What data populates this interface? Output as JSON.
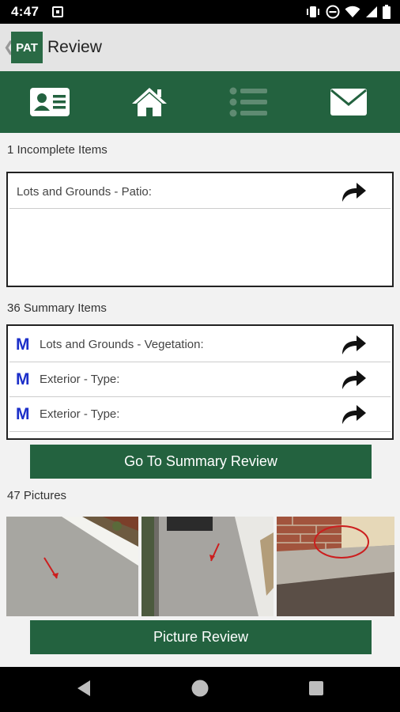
{
  "status_bar": {
    "time": "4:47"
  },
  "app_bar": {
    "logo_text": "PAT",
    "title": "Review"
  },
  "tabs": [
    {
      "name": "id-card-icon",
      "state": "active"
    },
    {
      "name": "home-icon",
      "state": "active"
    },
    {
      "name": "list-icon",
      "state": "disabled"
    },
    {
      "name": "envelope-icon",
      "state": "active"
    }
  ],
  "incomplete": {
    "label": "1 Incomplete Items",
    "items": [
      {
        "text": "Lots and Grounds - Patio:"
      }
    ]
  },
  "summary": {
    "label": "36 Summary Items",
    "items": [
      {
        "badge": "M",
        "text": "Lots and Grounds - Vegetation:"
      },
      {
        "badge": "M",
        "text": "Exterior - Type:"
      },
      {
        "badge": "M",
        "text": "Exterior - Type:"
      }
    ],
    "button_label": "Go To Summary Review"
  },
  "pictures": {
    "label": "47 Pictures",
    "button_label": "Picture Review"
  },
  "colors": {
    "brand_green": "#23623f",
    "badge_blue": "#1c2fc9",
    "annotation_red": "#cc1e1e"
  }
}
